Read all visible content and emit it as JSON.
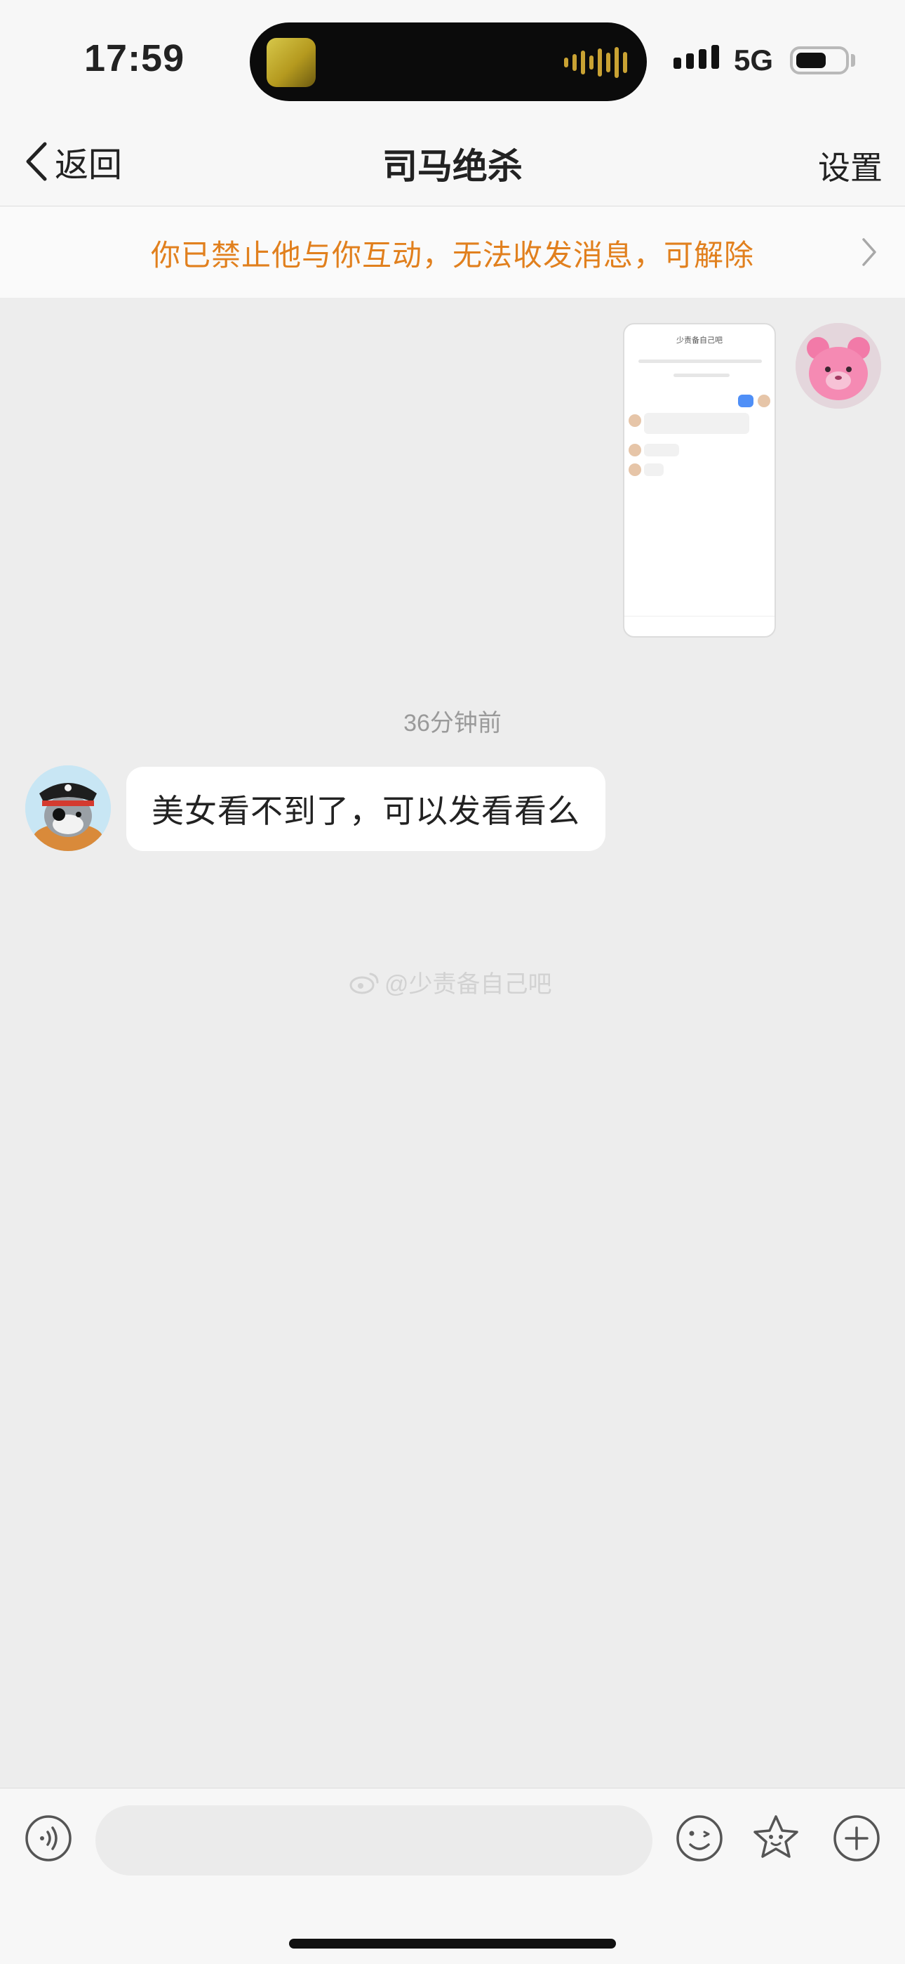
{
  "status_bar": {
    "time": "17:59",
    "network": "5G",
    "icons": [
      "signal-icon",
      "battery-icon"
    ]
  },
  "nav": {
    "back_label": "返回",
    "title": "司马绝杀",
    "settings_label": "设置"
  },
  "banner": {
    "text": "你已禁止他与你互动，无法收发消息，可解除"
  },
  "messages": [
    {
      "sender": "me",
      "type": "image"
    },
    {
      "type": "timestamp",
      "text": "36分钟前"
    },
    {
      "sender": "other",
      "type": "text",
      "text": "美女看不到了，可以发看看么"
    }
  ],
  "shared_image": {
    "header": "少责备自己吧"
  },
  "watermark": "@少责备自己吧",
  "input_bar": {
    "placeholder": "",
    "icons": [
      "voice-icon",
      "emoji-icon",
      "favorite-sticker-icon",
      "plus-icon"
    ]
  },
  "colors": {
    "banner_text": "#e1801e",
    "background": "#ededed",
    "bar": "#f7f7f7"
  }
}
